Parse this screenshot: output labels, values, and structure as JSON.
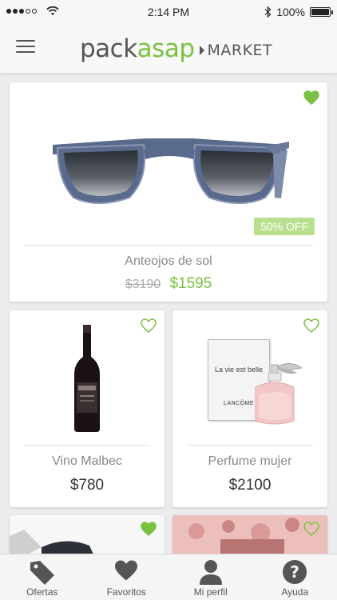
{
  "status_bar": {
    "time": "2:14 PM",
    "battery": "100%",
    "battery_level": 1.0
  },
  "header": {
    "logo_part1": "pack",
    "logo_part2": "asap",
    "logo_part3": "MARKET"
  },
  "products": [
    {
      "name": "Anteojos de sol",
      "old_price": "$3190",
      "price": "$1595",
      "badge": "50% OFF",
      "favorite": true
    },
    {
      "name": "Vino Malbec",
      "price": "$780",
      "favorite": false
    },
    {
      "name": "Perfume mujer",
      "price": "$2100",
      "favorite": false
    },
    {
      "favorite": true
    },
    {
      "favorite": false
    }
  ],
  "perfume_box": {
    "line1": "La vie est belle",
    "line2": "LANCÔME"
  },
  "tabs": [
    {
      "label": "Ofertas",
      "icon": "tag-icon"
    },
    {
      "label": "Favoritos",
      "icon": "heart-icon"
    },
    {
      "label": "Mi perfil",
      "icon": "user-icon"
    },
    {
      "label": "Ayuda",
      "icon": "help-icon"
    }
  ],
  "colors": {
    "accent": "#7ac142",
    "badge": "#b8e08f",
    "icon_gray": "#555555"
  }
}
